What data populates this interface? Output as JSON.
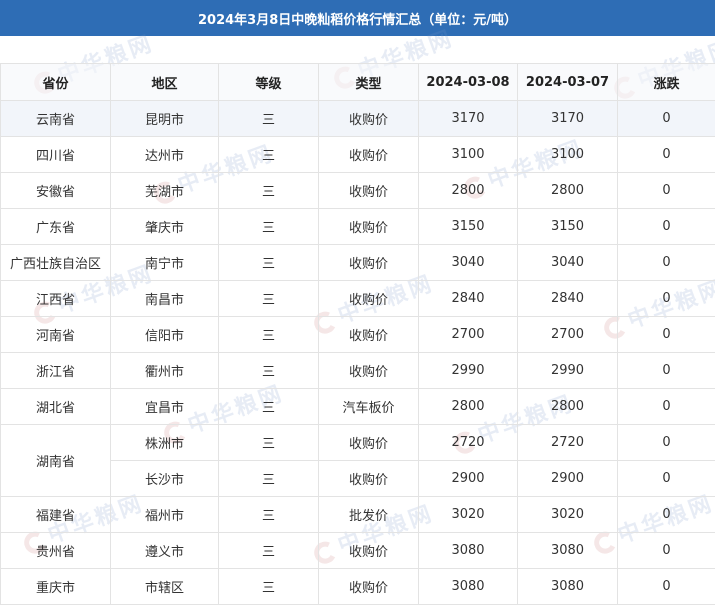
{
  "title": "2024年3月8日中晚籼稻价格行情汇总（单位：元/吨）",
  "watermark": "中华粮网",
  "table": {
    "headers": [
      "省份",
      "地区",
      "等级",
      "类型",
      "2024-03-08",
      "2024-03-07",
      "涨跌"
    ],
    "rows": [
      {
        "province": "云南省",
        "region": "昆明市",
        "grade": "三",
        "type": "收购价",
        "d1": "3170",
        "d2": "3170",
        "change": "0"
      },
      {
        "province": "四川省",
        "region": "达州市",
        "grade": "三",
        "type": "收购价",
        "d1": "3100",
        "d2": "3100",
        "change": "0"
      },
      {
        "province": "安徽省",
        "region": "芜湖市",
        "grade": "三",
        "type": "收购价",
        "d1": "2800",
        "d2": "2800",
        "change": "0"
      },
      {
        "province": "广东省",
        "region": "肇庆市",
        "grade": "三",
        "type": "收购价",
        "d1": "3150",
        "d2": "3150",
        "change": "0"
      },
      {
        "province": "广西壮族自治区",
        "region": "南宁市",
        "grade": "三",
        "type": "收购价",
        "d1": "3040",
        "d2": "3040",
        "change": "0"
      },
      {
        "province": "江西省",
        "region": "南昌市",
        "grade": "三",
        "type": "收购价",
        "d1": "2840",
        "d2": "2840",
        "change": "0"
      },
      {
        "province": "河南省",
        "region": "信阳市",
        "grade": "三",
        "type": "收购价",
        "d1": "2700",
        "d2": "2700",
        "change": "0"
      },
      {
        "province": "浙江省",
        "region": "衢州市",
        "grade": "三",
        "type": "收购价",
        "d1": "2990",
        "d2": "2990",
        "change": "0"
      },
      {
        "province": "湖北省",
        "region": "宜昌市",
        "grade": "三",
        "type": "汽车板价",
        "d1": "2800",
        "d2": "2800",
        "change": "0"
      },
      {
        "province": "湖南省",
        "region": "株洲市",
        "grade": "三",
        "type": "收购价",
        "d1": "2720",
        "d2": "2720",
        "change": "0"
      },
      {
        "province": "湖南省",
        "region": "长沙市",
        "grade": "三",
        "type": "收购价",
        "d1": "2900",
        "d2": "2900",
        "change": "0"
      },
      {
        "province": "福建省",
        "region": "福州市",
        "grade": "三",
        "type": "批发价",
        "d1": "3020",
        "d2": "3020",
        "change": "0"
      },
      {
        "province": "贵州省",
        "region": "遵义市",
        "grade": "三",
        "type": "收购价",
        "d1": "3080",
        "d2": "3080",
        "change": "0"
      },
      {
        "province": "重庆市",
        "region": "市辖区",
        "grade": "三",
        "type": "收购价",
        "d1": "3080",
        "d2": "3080",
        "change": "0"
      }
    ]
  },
  "colors": {
    "title_bg": "#2e6db5",
    "title_text": "#ffffff",
    "highlight_row": "#ecf1f8"
  }
}
